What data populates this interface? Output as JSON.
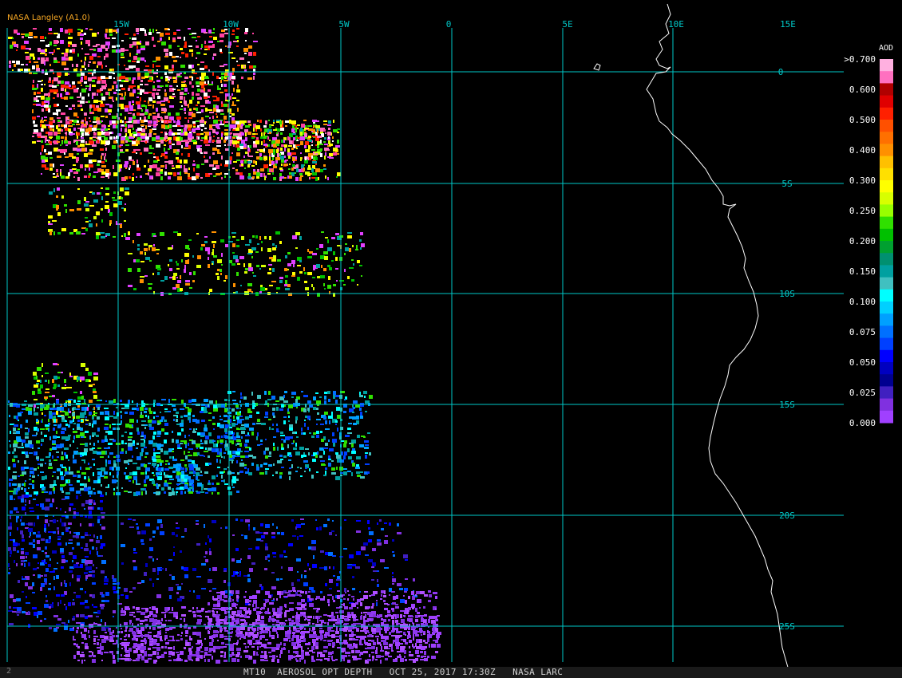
{
  "credit": "NASA Langley (A1.0)",
  "footer": {
    "mark": "2",
    "text": "MT10  AEROSOL OPT DEPTH   OCT 25, 2017 17:30Z   NASA LARC"
  },
  "grid": {
    "color": "#00c8c8",
    "lon_labels": [
      "15W",
      "10W",
      "5W",
      "0",
      "5E",
      "10E",
      "15E"
    ],
    "lat_labels": [
      "0",
      "5S",
      "10S",
      "15S",
      "20S",
      "25S"
    ]
  },
  "legend": {
    "title": "AOD",
    "tick_labels": [
      ">0.700",
      "0.600",
      "0.500",
      "0.400",
      "0.300",
      "0.250",
      "0.200",
      "0.150",
      "0.100",
      "0.075",
      "0.050",
      "0.025",
      "0.000"
    ],
    "colors": [
      "#ffb0e0",
      "#ff70c0",
      "#b00000",
      "#e00000",
      "#ff2000",
      "#ff5000",
      "#ff7000",
      "#ff9000",
      "#ffc000",
      "#ffe000",
      "#ffff00",
      "#d8ff00",
      "#98ff00",
      "#30e000",
      "#00c000",
      "#00a030",
      "#009070",
      "#00a0a0",
      "#40c0c0",
      "#00ffff",
      "#00d0ff",
      "#00a0ff",
      "#0070ff",
      "#0040ff",
      "#0000ff",
      "#0000c0",
      "#000090",
      "#4020c0",
      "#8030e0",
      "#a040ff"
    ]
  },
  "coastline_color": "#ffffff",
  "aerosol_colors": {
    "high": [
      "#ff70c0",
      "#ff40a0",
      "#e040ff",
      "#ffff00",
      "#ff9000",
      "#30e000",
      "#ff2000",
      "#ffffff"
    ],
    "mid": [
      "#30e000",
      "#00c000",
      "#d8ff00",
      "#ffff00",
      "#ff9000",
      "#e040ff",
      "#00a0a0"
    ],
    "low": [
      "#00a0a0",
      "#00ffff",
      "#00a0ff",
      "#0070ff",
      "#30e000",
      "#40c0c0",
      "#0040ff"
    ],
    "vlow": [
      "#0040ff",
      "#0000ff",
      "#0070ff",
      "#0000c0",
      "#4020c0",
      "#8030e0"
    ],
    "purple": [
      "#a040ff",
      "#8030e0",
      "#9038f0",
      "#b050ff"
    ]
  }
}
